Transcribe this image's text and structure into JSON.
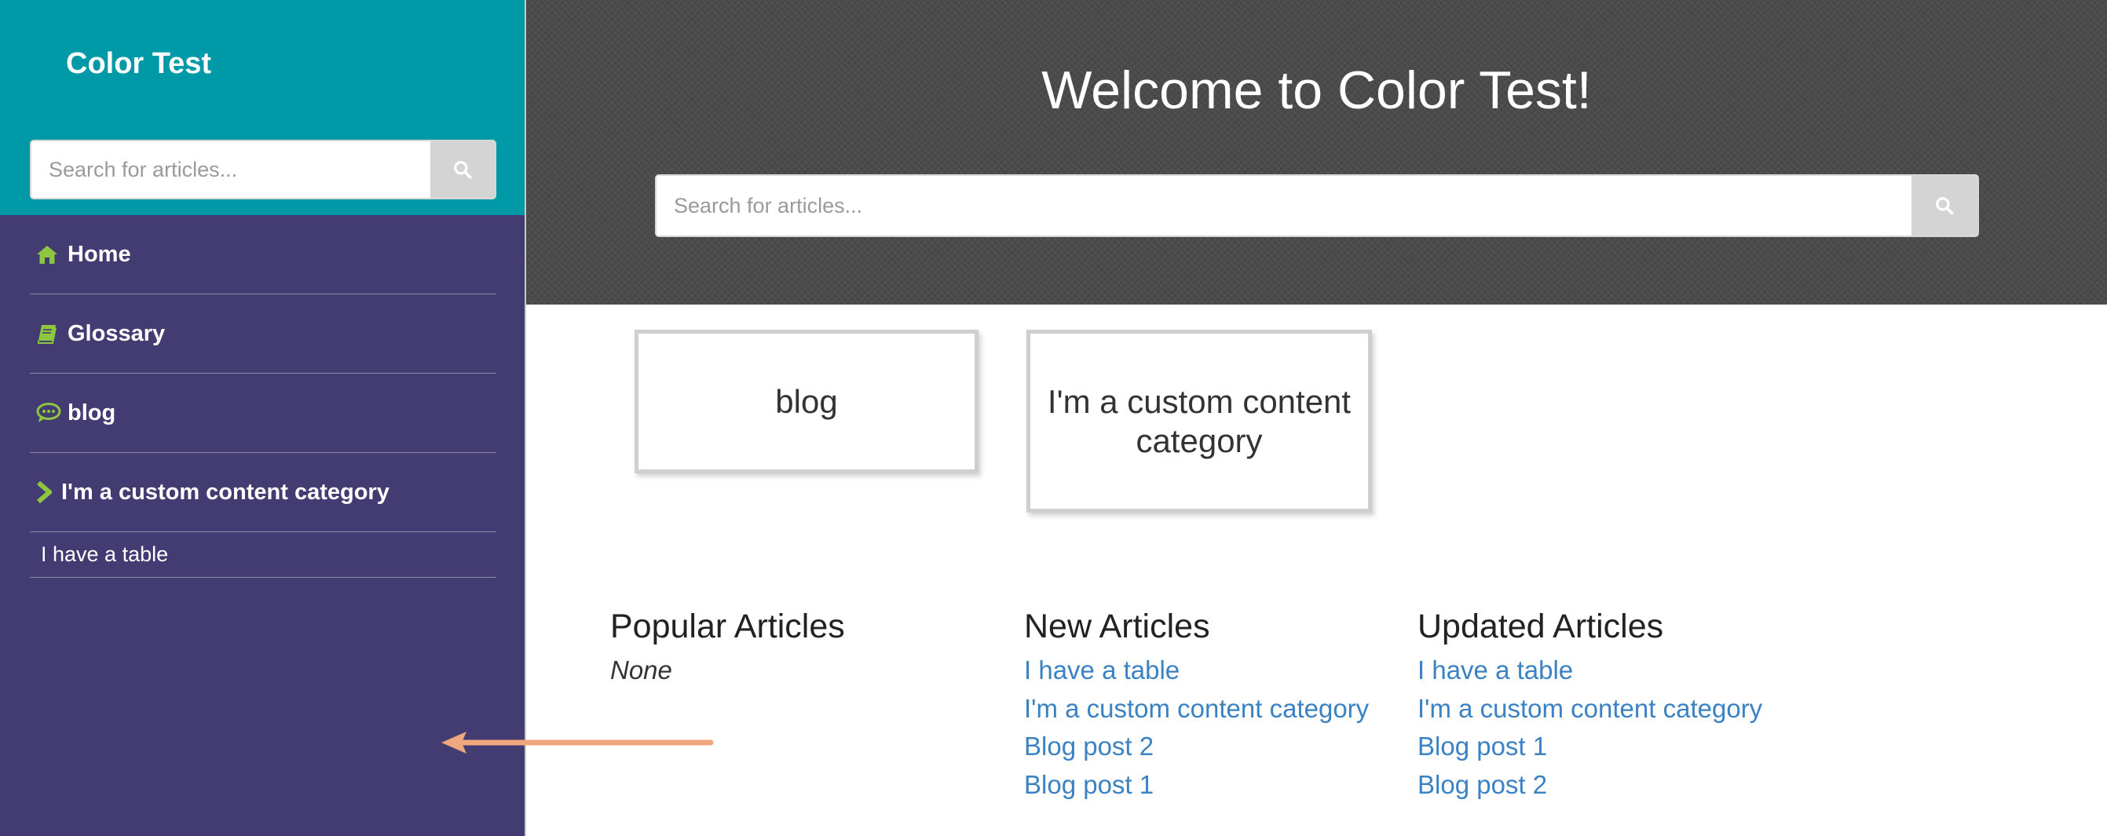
{
  "sidebar": {
    "brand": "Color Test",
    "search_placeholder": "Search for articles...",
    "items": [
      {
        "label": "Home",
        "icon": "home-icon"
      },
      {
        "label": "Glossary",
        "icon": "book-icon"
      },
      {
        "label": "blog",
        "icon": "comment-icon"
      },
      {
        "label": "I'm a custom content category",
        "icon": "chevron-right-icon"
      }
    ],
    "subitems": [
      {
        "label": "I have a table"
      }
    ]
  },
  "hero": {
    "title": "Welcome to Color Test!",
    "search_placeholder": "Search for articles..."
  },
  "categories": [
    {
      "label": "blog"
    },
    {
      "label": "I'm a custom content category"
    }
  ],
  "popular": {
    "heading": "Popular Articles",
    "empty_text": "None"
  },
  "new_articles": {
    "heading": "New Articles",
    "links": [
      "I have a table",
      "I'm a custom content category",
      "Blog post 2",
      "Blog post 1"
    ]
  },
  "updated_articles": {
    "heading": "Updated Articles",
    "links": [
      "I have a table",
      "I'm a custom content category",
      "Blog post 1",
      "Blog post 2"
    ]
  },
  "colors": {
    "sidebar_bg": "#433c73",
    "sidebar_top_bg": "#0099a8",
    "icon_green": "#8dc63f",
    "link_blue": "#3a82c4",
    "hero_bg": "#4b4b4b",
    "arrow": "#f0a77e"
  }
}
